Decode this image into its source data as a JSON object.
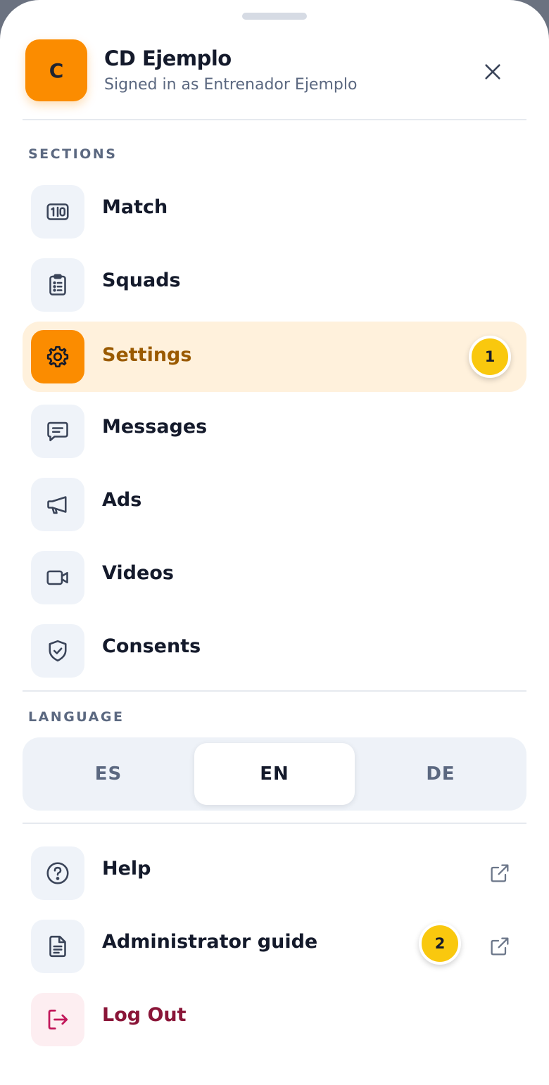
{
  "header": {
    "avatar_initial": "C",
    "club_name": "CD Ejemplo",
    "signed_in_text": "Signed in as Entrenador Ejemplo",
    "close_icon": "close-icon"
  },
  "sections": {
    "title": "SECTIONS",
    "items": [
      {
        "label": "Match",
        "icon": "scoreboard-icon",
        "active": false
      },
      {
        "label": "Squads",
        "icon": "clipboard-list-icon",
        "active": false
      },
      {
        "label": "Settings",
        "icon": "gear-icon",
        "active": true,
        "badge": "1"
      },
      {
        "label": "Messages",
        "icon": "message-icon",
        "active": false
      },
      {
        "label": "Ads",
        "icon": "megaphone-icon",
        "active": false
      },
      {
        "label": "Videos",
        "icon": "video-camera-icon",
        "active": false
      },
      {
        "label": "Consents",
        "icon": "shield-check-icon",
        "active": false
      }
    ]
  },
  "language": {
    "title": "LANGUAGE",
    "options": [
      "ES",
      "EN",
      "DE"
    ],
    "selected": "EN"
  },
  "footer_links": [
    {
      "label": "Help",
      "icon": "help-circle-icon",
      "external_icon": "external-link-icon"
    },
    {
      "label": "Administrator guide",
      "icon": "document-icon",
      "external_icon": "external-link-icon",
      "badge": "2"
    }
  ],
  "logout": {
    "label": "Log Out",
    "icon": "logout-icon"
  },
  "colors": {
    "accent": "#fb8c00",
    "active_bg": "#fff1dc",
    "active_text": "#9a5a00",
    "badge": "#f9c80e",
    "logout_text": "#8a1538",
    "icon_tile": "#eff3f9"
  }
}
